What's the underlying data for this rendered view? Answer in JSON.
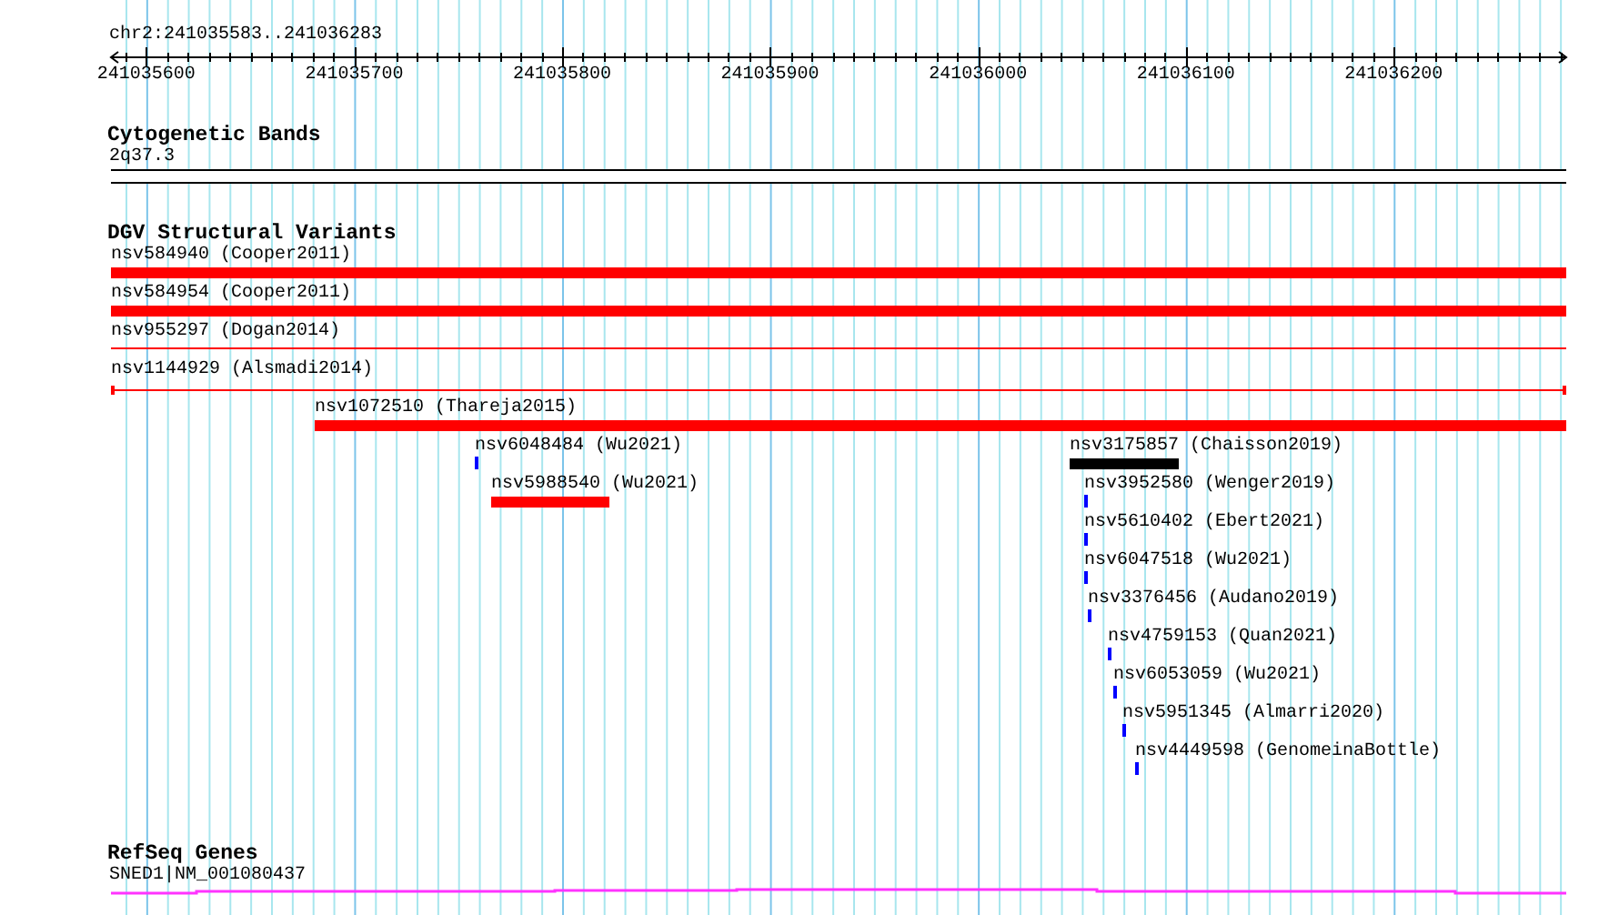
{
  "ruler": {
    "location": "chr2:241035583..241036283",
    "labels": [
      "241035600",
      "241035700",
      "241035800",
      "241035900",
      "241036000",
      "241036100",
      "241036200"
    ]
  },
  "cytobands": {
    "title": "Cytogenetic Bands",
    "label": "2q37.3"
  },
  "variants": {
    "title": "DGV Structural Variants",
    "features": [
      {
        "label": "nsv584940 (Cooper2011)",
        "color": "#ff0000",
        "kind": "thick"
      },
      {
        "label": "nsv584954 (Cooper2011)",
        "color": "#ff0000",
        "kind": "thick"
      },
      {
        "label": "nsv955297 (Dogan2014)",
        "color": "#ff0000",
        "kind": "line"
      },
      {
        "label": "nsv1144929 (Alsmadi2014)",
        "color": "#ff0000",
        "kind": "span"
      },
      {
        "label": "nsv1072510 (Thareja2015)",
        "color": "#ff0000",
        "kind": "thick"
      },
      {
        "label": "nsv6048484 (Wu2021)",
        "color": "#0000ff",
        "kind": "tick"
      },
      {
        "label": "nsv5988540 (Wu2021)",
        "color": "#ff0000",
        "kind": "thick"
      },
      {
        "label": "nsv3175857 (Chaisson2019)",
        "color": "#000000",
        "kind": "thick"
      },
      {
        "label": "nsv3952580 (Wenger2019)",
        "color": "#0000ff",
        "kind": "tick"
      },
      {
        "label": "nsv5610402 (Ebert2021)",
        "color": "#0000ff",
        "kind": "tick"
      },
      {
        "label": "nsv6047518 (Wu2021)",
        "color": "#0000ff",
        "kind": "tick"
      },
      {
        "label": "nsv3376456 (Audano2019)",
        "color": "#0000ff",
        "kind": "tick"
      },
      {
        "label": "nsv4759153 (Quan2021)",
        "color": "#0000ff",
        "kind": "tick"
      },
      {
        "label": "nsv6053059 (Wu2021)",
        "color": "#0000ff",
        "kind": "tick"
      },
      {
        "label": "nsv5951345 (Almarri2020)",
        "color": "#0000ff",
        "kind": "tick"
      },
      {
        "label": "nsv4449598 (GenomeinaBottle)",
        "color": "#0000ff",
        "kind": "tick"
      }
    ]
  },
  "genes": {
    "title": "RefSeq Genes",
    "label": "SNED1|NM_001080437",
    "color": "#ff33ff"
  }
}
